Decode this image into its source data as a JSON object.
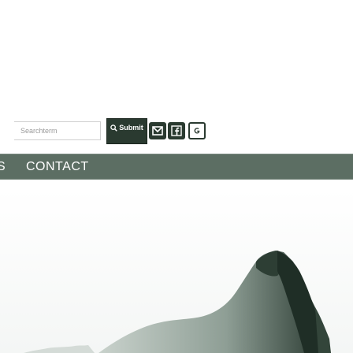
{
  "search": {
    "placeholder": "Searchterm",
    "submit_label": "Submit"
  },
  "social": {
    "email_icon": "email-icon",
    "facebook_icon": "facebook-icon",
    "gplus_icon": "google-plus-icon"
  },
  "nav": {
    "items": [
      {
        "label": "S"
      },
      {
        "label": "CONTACT"
      }
    ]
  },
  "colors": {
    "brand_dark": "#2a3a30",
    "nav_bg": "#5c6e63",
    "image_sky": "#9fb0a6",
    "image_dark": "#24342b"
  }
}
